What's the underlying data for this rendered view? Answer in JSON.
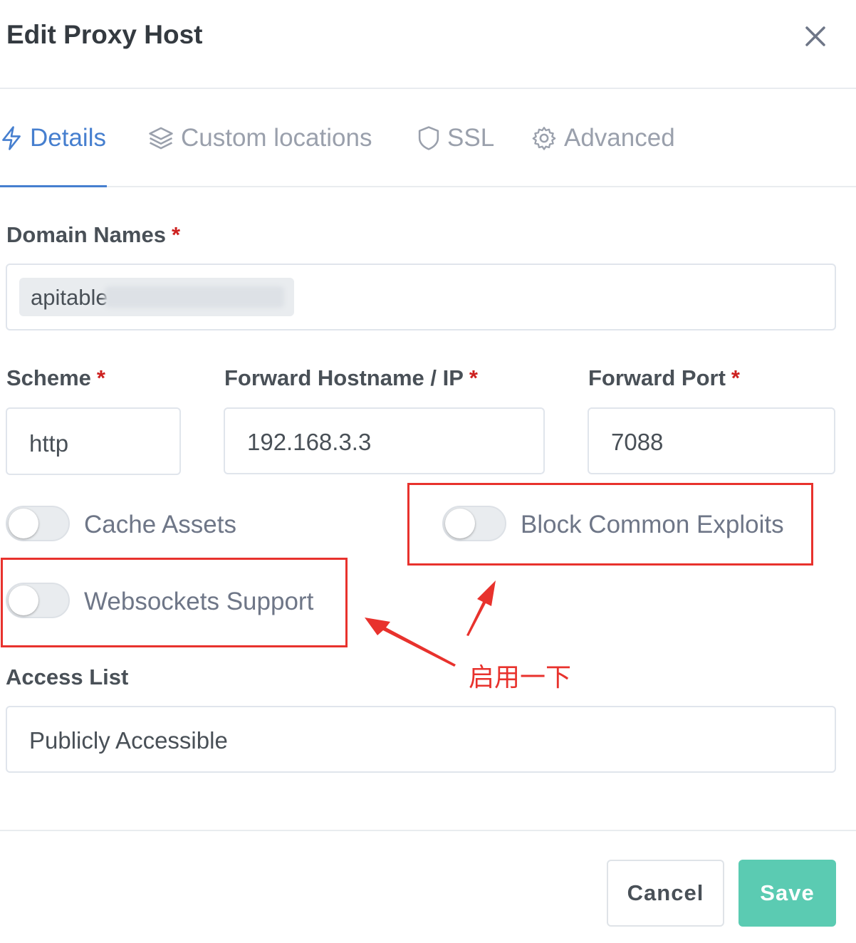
{
  "modal": {
    "title": "Edit Proxy Host"
  },
  "tabs": [
    {
      "label": "Details",
      "icon": "lightning-icon",
      "active": true
    },
    {
      "label": "Custom locations",
      "icon": "layers-icon",
      "active": false
    },
    {
      "label": "SSL",
      "icon": "shield-icon",
      "active": false
    },
    {
      "label": "Advanced",
      "icon": "gear-icon",
      "active": false
    }
  ],
  "form": {
    "domain_names": {
      "label": "Domain Names",
      "required": "*",
      "chip": "apitable"
    },
    "scheme": {
      "label": "Scheme",
      "required": "*",
      "value": "http"
    },
    "forward_hostname": {
      "label": "Forward Hostname / IP",
      "required": "*",
      "value": "192.168.3.3"
    },
    "forward_port": {
      "label": "Forward Port",
      "required": "*",
      "value": "7088"
    },
    "toggles": {
      "cache_assets": {
        "label": "Cache Assets",
        "on": false
      },
      "block_exploits": {
        "label": "Block Common Exploits",
        "on": false
      },
      "websockets": {
        "label": "Websockets Support",
        "on": false
      }
    },
    "access_list": {
      "label": "Access List",
      "value": "Publicly Accessible"
    }
  },
  "annotation": {
    "text": "启用一下",
    "color": "#e8322d"
  },
  "footer": {
    "cancel_label": "Cancel",
    "save_label": "Save"
  },
  "colors": {
    "accent": "#467fcf",
    "required": "#cd201f",
    "save_button": "#5bcbb2"
  }
}
